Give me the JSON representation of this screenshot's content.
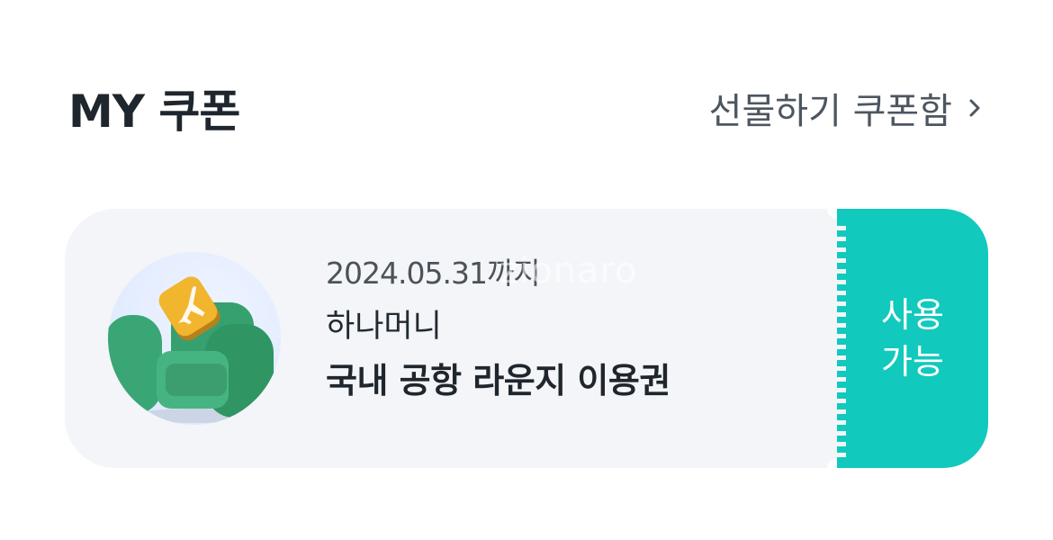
{
  "header": {
    "title": "MY 쿠폰",
    "gift_link_label": "선물하기 쿠폰함"
  },
  "coupon": {
    "expiry": "2024.05.31까지",
    "brand": "하나머니",
    "name": "국내 공항 라운지 이용권",
    "status_line1": "사용",
    "status_line2": "가능",
    "image_icon": "airplane-lounge-chair-icon",
    "accent_color": "#12c9bd"
  },
  "watermark": "zionaro"
}
